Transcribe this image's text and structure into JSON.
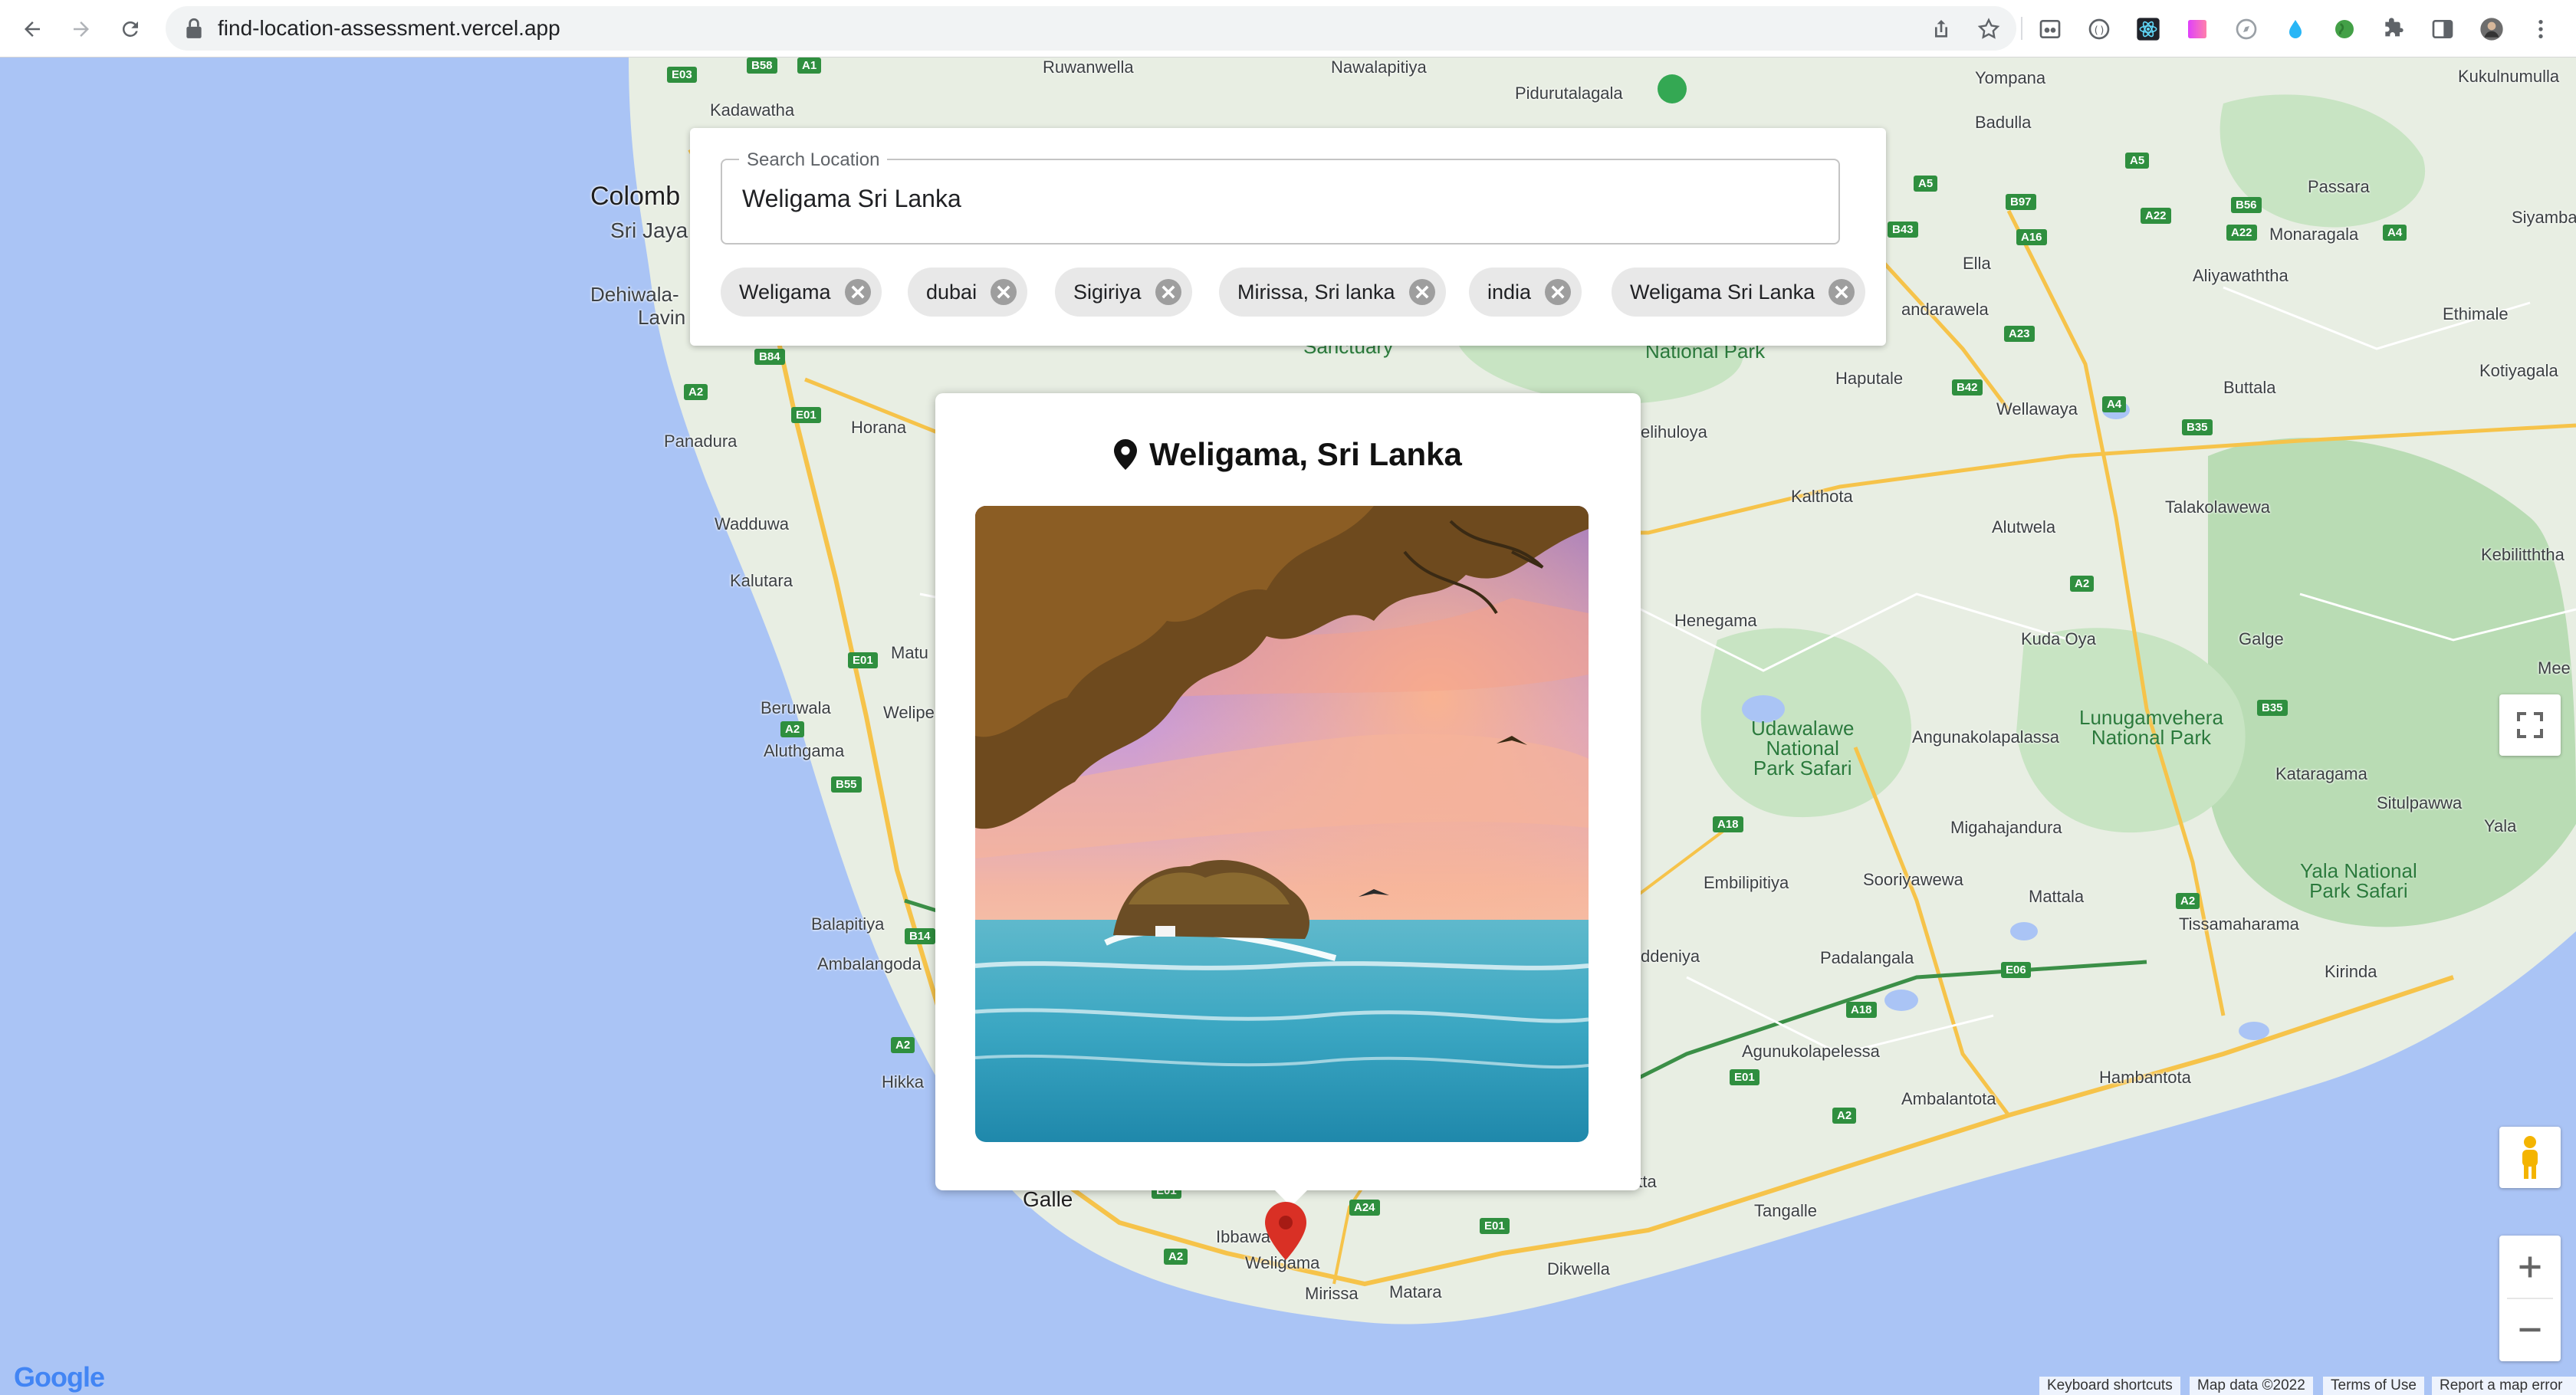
{
  "browser": {
    "url": "find-location-assessment.vercel.app"
  },
  "search": {
    "legend": "Search Location",
    "value": "Weligama Sri Lanka"
  },
  "chips": [
    {
      "label": "Weligama"
    },
    {
      "label": "dubai"
    },
    {
      "label": "Sigiriya"
    },
    {
      "label": "Mirissa, Sri lanka"
    },
    {
      "label": "india"
    },
    {
      "label": "Weligama Sri Lanka"
    }
  ],
  "info_window": {
    "title": "Weligama, Sri Lanka"
  },
  "map": {
    "places": {
      "ruwanwella": "Ruwanwella",
      "nawalapitiya": "Nawalapitiya",
      "yompana": "Yompana",
      "nuwara_kukulnumulla": "Kukulnumulla",
      "kadawatha": "Kadawatha",
      "pidurutalagala": "Pidurutalagala",
      "badulla": "Badulla",
      "colombo": "Colomb",
      "sri_jaya": "Sri Jaya",
      "passara": "Passara",
      "siyambalan": "Siyambalan",
      "monaragala": "Monaragala",
      "ella": "Ella",
      "aliyawaththa": "Aliyawaththa",
      "dehiwala": "Dehiwala-",
      "lavin": "Lavin",
      "bandarawela": "andarawela",
      "ethimale": "Ethimale",
      "sanctuary": "Sanctuary",
      "national_park": "National Park",
      "haputale": "Haputale",
      "wellawaya": "Wellawaya",
      "buttala": "Buttala",
      "kotiyagala": "Kotiyagala",
      "horana": "Horana",
      "belihuloya": "elihuloya",
      "panadura": "Panadura",
      "kalthota": "Kalthota",
      "talakolawewa": "Talakolawewa",
      "alutwela": "Alutwela",
      "wadduwa": "Wadduwa",
      "kebilitththa": "Kebilitththa",
      "kalutara": "Kalutara",
      "henegama": "Henegama",
      "kuda_oya": "Kuda Oya",
      "galge": "Galge",
      "matu": "Matu",
      "meel": "Mee",
      "beruwala": "Beruwala",
      "welipe": "Welipe",
      "udawalawe": "Udawalawe\nNational\nPark Safari",
      "angunakolapalassa": "Angunakolapalassa",
      "lunugamvehera": "Lunugamvehera\nNational Park",
      "aluthgama": "Aluthgama",
      "kataragama": "Kataragama",
      "migahajandura": "Migahajandura",
      "situlpawwa": "Situlpawwa",
      "yala": "Yala",
      "yala_np": "Yala National\nPark Safari",
      "embilipitiya": "Embilipitiya",
      "sooriyawewa": "Sooriyawewa",
      "mattala": "Mattala",
      "balapitiya": "Balapitiya",
      "tissamaharama": "Tissamaharama",
      "ambalangoda": "Ambalangoda",
      "padalangala": "Padalangala",
      "kirinda": "Kirinda",
      "middeniya": "ddeniya",
      "agunukolapelessa": "Agunukolapelessa",
      "hikkaduwa": "Hikka",
      "hambantota": "Hambantota",
      "ambalantota": "Ambalantota",
      "galle": "Galle",
      "tangalle": "Tangalle",
      "ibbawala": "Ibbawa",
      "weligama": "Weligama",
      "dikwella": "Dikwella",
      "mirissa": "Mirissa",
      "matara": "Matara",
      "akuressa": "atta"
    },
    "shields": [
      "E03",
      "B58",
      "A1",
      "E01",
      "A2",
      "B84",
      "E01",
      "A2",
      "B55",
      "B14",
      "A2",
      "A5",
      "A5",
      "B97",
      "A22",
      "B56",
      "A22",
      "A4",
      "A5",
      "A16",
      "B43",
      "A23",
      "B42",
      "A4",
      "B35",
      "A2",
      "B35",
      "A18",
      "A2",
      "E06",
      "A18",
      "E01",
      "A2",
      "A24",
      "E01",
      "A2",
      "E01"
    ],
    "attribution": {
      "keyboard": "Keyboard shortcuts",
      "map_data": "Map data ©2022",
      "terms": "Terms of Use",
      "report": "Report a map error"
    },
    "logo": "Google"
  },
  "colors": {
    "water": "#aac4f5",
    "land": "#e8eee3",
    "park": "#b9dcb4",
    "road_major": "#f6c34a",
    "road_minor": "#ffffff",
    "marker": "#d93025"
  }
}
